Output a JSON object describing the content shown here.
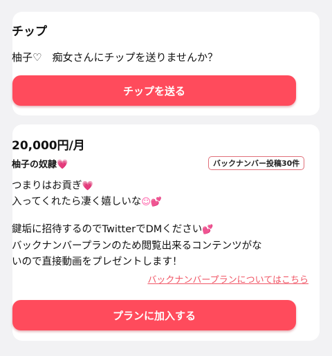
{
  "tip": {
    "title": "チップ",
    "recipient_name": "柚子",
    "recipient_suffix": "♡",
    "message": "　痴女さんにチップを送りませんか？",
    "button_label": "チップを送る"
  },
  "plan": {
    "price": "20,000円/月",
    "name": "柚子の奴隷",
    "name_emoji": "💗",
    "backnumber_badge": "バックナンバー投稿30件",
    "description": [
      {
        "text": "つまりはお貢ぎ",
        "emoji": "💗"
      },
      {
        "text": "入ってくれたら凄く嬉しいな",
        "emoji": "☺💕"
      },
      {
        "text": "鍵垢に招待するのでTwitterでDMください",
        "emoji": "💕"
      },
      {
        "text": "バックナンバープランのため閲覧出来るコンテンツがな",
        "emoji": ""
      },
      {
        "text": "いので直接動画をプレゼントします！",
        "emoji": ""
      }
    ],
    "backnumber_link": "バックナンバープランについてはこちら",
    "join_button_label": "プランに加入する"
  },
  "colors": {
    "accent": "#ff4b5c",
    "link": "#f05565",
    "heart": "#ff4fa0",
    "background": "#f2f2f4",
    "card": "#ffffff"
  }
}
